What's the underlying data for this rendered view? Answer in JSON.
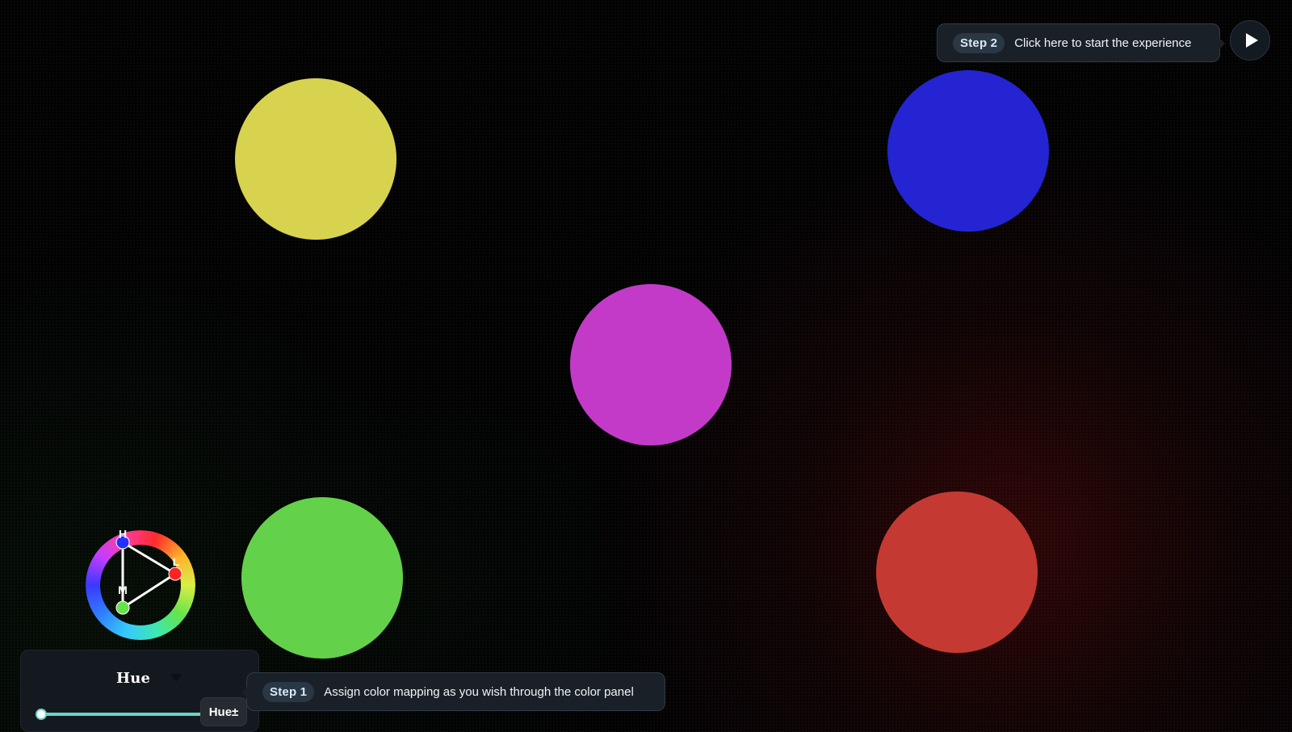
{
  "colors": {
    "background": "#020203",
    "yellow_circle": "#d8d34f",
    "blue_circle": "#2424d2",
    "magenta_circle": "#c33ac9",
    "green_circle": "#64d14b",
    "red_circle": "#c43a33",
    "tooltip_bg": "#1a2027",
    "slider_accent": "#6dd2c8"
  },
  "circles": [
    {
      "name": "yellow-circle",
      "color": "#d8d34f"
    },
    {
      "name": "blue-circle",
      "color": "#2424d2"
    },
    {
      "name": "magenta-circle",
      "color": "#c33ac9"
    },
    {
      "name": "green-circle",
      "color": "#64d14b"
    },
    {
      "name": "red-circle",
      "color": "#c43a33"
    }
  ],
  "play_button": {
    "icon": "play-icon"
  },
  "step2_tooltip": {
    "step_label": "Step 2",
    "text": "Click here to start the experience"
  },
  "step1_tooltip": {
    "step_label": "Step 1",
    "text": "Assign color mapping as you wish through the color panel"
  },
  "color_wheel": {
    "labels": {
      "h": "H",
      "l": "L",
      "m": "M"
    },
    "handles": [
      {
        "name": "h-handle",
        "color": "#2430ff"
      },
      {
        "name": "l-handle",
        "color": "#ff2222"
      },
      {
        "name": "m-handle",
        "color": "#66e34b"
      }
    ]
  },
  "panel": {
    "title": "Hue",
    "mode_label": "Hue±",
    "slider_value_fraction": 0.0
  }
}
